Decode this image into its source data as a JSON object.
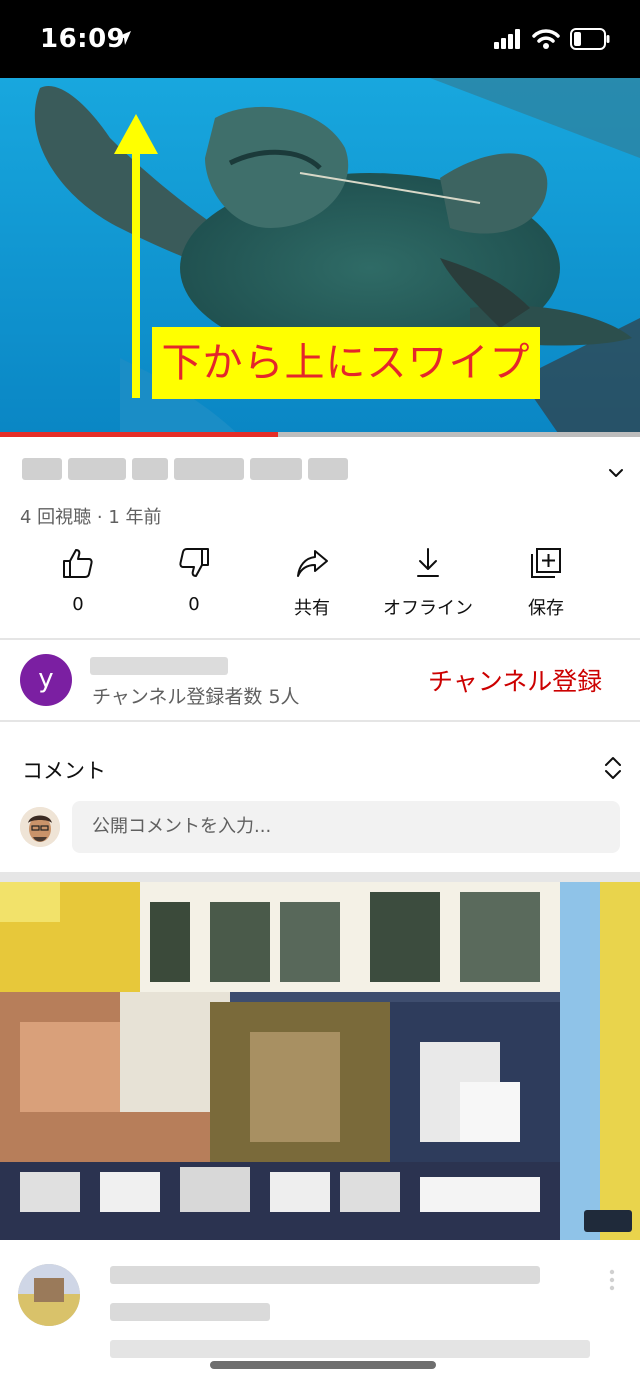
{
  "status_bar": {
    "time": "16:09"
  },
  "video": {
    "overlay_text": "下から上にスワイプ",
    "progress_fraction": 0.434
  },
  "details": {
    "meta": "4 回視聴 · 1 年前"
  },
  "actions": [
    {
      "icon": "thumbs-up-icon",
      "label": "0"
    },
    {
      "icon": "thumbs-down-icon",
      "label": "0"
    },
    {
      "icon": "share-icon",
      "label": "共有"
    },
    {
      "icon": "download-icon",
      "label": "オフライン"
    },
    {
      "icon": "save-playlist-icon",
      "label": "保存"
    }
  ],
  "channel": {
    "avatar_letter": "y",
    "subscribers": "チャンネル登録者数 5人",
    "subscribe_label": "チャンネル登録"
  },
  "comments": {
    "title": "コメント",
    "placeholder": "公開コメントを入力..."
  },
  "colors": {
    "accent_red": "#cc0000",
    "progress_red": "#e52d27",
    "overlay_yellow": "#ffff00",
    "avatar_purple": "#7b1fa2"
  }
}
